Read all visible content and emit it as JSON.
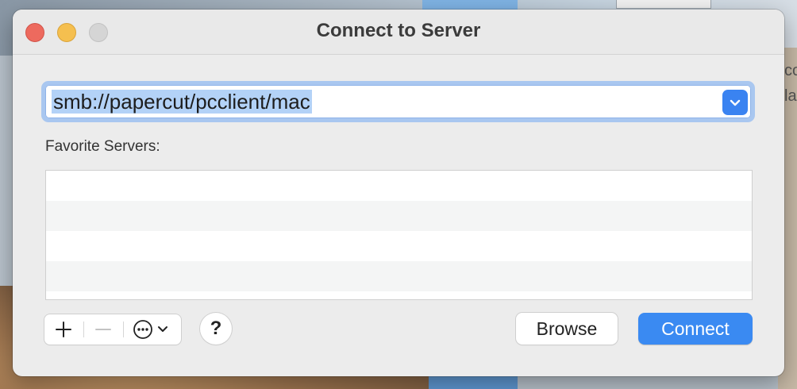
{
  "window": {
    "title": "Connect to Server"
  },
  "address": {
    "value": "smb://papercut/pcclient/mac"
  },
  "favorites": {
    "label": "Favorite Servers:",
    "rows": [
      "",
      "",
      "",
      ""
    ]
  },
  "buttons": {
    "browse": "Browse",
    "connect": "Connect",
    "help": "?"
  },
  "background": {
    "peek_lines": [
      "co",
      "la"
    ]
  },
  "icons": {
    "dropdown": "chevron-down-icon",
    "add": "plus-icon",
    "remove": "minus-icon",
    "more": "ellipsis-circle-icon",
    "help": "question-mark-icon"
  },
  "colors": {
    "accent": "#3a8af2",
    "selection": "#b3d2f7"
  }
}
